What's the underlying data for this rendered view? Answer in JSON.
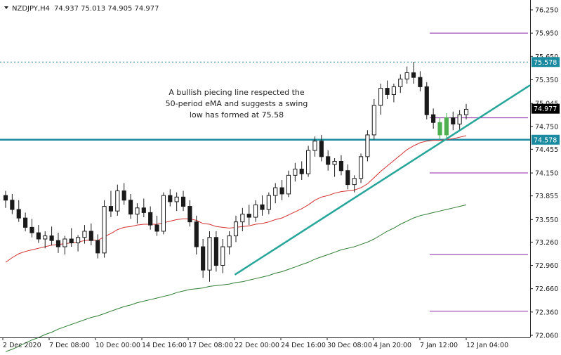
{
  "header": {
    "symbol_info": "NZDJPY,H4",
    "ohlc": "74.937 75.013 74.905 74.977"
  },
  "annotation": {
    "lines": [
      "A bullish piecing line respected the",
      "50-period eMA and suggests a swing",
      "low has formed at 75.58"
    ]
  },
  "colors": {
    "candle": "#1a1a1a",
    "highlight": "#4caf50",
    "ema_fast": "#d32f2f",
    "ema_slow": "#2e7d32",
    "trendline": "#26a69a",
    "support_line": "#1a8aa0",
    "level_lines": "#8e24aa",
    "price_tag": "#1a8aa0",
    "current_tag": "#000000"
  },
  "chart_data": {
    "type": "candlestick",
    "y_ticks": [
      "76.250",
      "75.950",
      "75.650",
      "75.350",
      "75.045",
      "74.750",
      "74.455",
      "74.150",
      "73.855",
      "73.550",
      "73.260",
      "72.960",
      "72.660",
      "72.360",
      "72.060"
    ],
    "x_ticks": [
      "2 Dec 2020",
      "7 Dec 08:00",
      "10 Dec 00:00",
      "14 Dec 16:00",
      "17 Dec 08:00",
      "22 Dec 00:00",
      "24 Dec 16:00",
      "30 Dec 08:00",
      "4 Jan 20:00",
      "7 Jan 12:00",
      "12 Jan 04:00"
    ],
    "ylim": [
      72.06,
      76.25
    ],
    "current_price": "74.977",
    "dotted_level": "75.578",
    "support_level": "74.578",
    "horizontal_levels": [
      75.95,
      74.86,
      74.15,
      73.1,
      72.37
    ],
    "trendline": {
      "from": [
        0.44,
        72.84
      ],
      "to": [
        1.0,
        75.28
      ]
    },
    "candles": [
      {
        "o": 73.86,
        "h": 73.92,
        "l": 73.7,
        "c": 73.8
      },
      {
        "o": 73.8,
        "h": 73.88,
        "l": 73.62,
        "c": 73.68
      },
      {
        "o": 73.68,
        "h": 73.8,
        "l": 73.52,
        "c": 73.57
      },
      {
        "o": 73.57,
        "h": 73.64,
        "l": 73.4,
        "c": 73.45
      },
      {
        "o": 73.45,
        "h": 73.56,
        "l": 73.32,
        "c": 73.38
      },
      {
        "o": 73.38,
        "h": 73.48,
        "l": 73.25,
        "c": 73.3
      },
      {
        "o": 73.3,
        "h": 73.4,
        "l": 73.18,
        "c": 73.34
      },
      {
        "o": 73.34,
        "h": 73.46,
        "l": 73.22,
        "c": 73.28
      },
      {
        "o": 73.28,
        "h": 73.38,
        "l": 73.12,
        "c": 73.2
      },
      {
        "o": 73.2,
        "h": 73.34,
        "l": 73.1,
        "c": 73.3
      },
      {
        "o": 73.3,
        "h": 73.44,
        "l": 73.2,
        "c": 73.25
      },
      {
        "o": 73.25,
        "h": 73.35,
        "l": 73.14,
        "c": 73.32
      },
      {
        "o": 73.32,
        "h": 73.48,
        "l": 73.24,
        "c": 73.4
      },
      {
        "o": 73.4,
        "h": 73.5,
        "l": 73.22,
        "c": 73.28
      },
      {
        "o": 73.28,
        "h": 73.36,
        "l": 73.05,
        "c": 73.12
      },
      {
        "o": 73.12,
        "h": 73.8,
        "l": 73.06,
        "c": 73.72
      },
      {
        "o": 73.72,
        "h": 73.92,
        "l": 73.58,
        "c": 73.66
      },
      {
        "o": 73.66,
        "h": 74.0,
        "l": 73.6,
        "c": 73.92
      },
      {
        "o": 73.92,
        "h": 74.02,
        "l": 73.74,
        "c": 73.8
      },
      {
        "o": 73.8,
        "h": 73.88,
        "l": 73.56,
        "c": 73.62
      },
      {
        "o": 73.62,
        "h": 73.76,
        "l": 73.5,
        "c": 73.7
      },
      {
        "o": 73.7,
        "h": 73.82,
        "l": 73.58,
        "c": 73.64
      },
      {
        "o": 73.64,
        "h": 73.72,
        "l": 73.42,
        "c": 73.48
      },
      {
        "o": 73.48,
        "h": 73.6,
        "l": 73.34,
        "c": 73.4
      },
      {
        "o": 73.4,
        "h": 73.9,
        "l": 73.36,
        "c": 73.86
      },
      {
        "o": 73.86,
        "h": 73.94,
        "l": 73.72,
        "c": 73.78
      },
      {
        "o": 73.78,
        "h": 73.9,
        "l": 73.66,
        "c": 73.84
      },
      {
        "o": 73.84,
        "h": 73.92,
        "l": 73.66,
        "c": 73.72
      },
      {
        "o": 73.72,
        "h": 73.8,
        "l": 73.46,
        "c": 73.52
      },
      {
        "o": 73.52,
        "h": 73.6,
        "l": 73.1,
        "c": 73.2
      },
      {
        "o": 73.2,
        "h": 73.3,
        "l": 72.8,
        "c": 72.9
      },
      {
        "o": 72.9,
        "h": 73.4,
        "l": 72.75,
        "c": 73.32
      },
      {
        "o": 73.32,
        "h": 73.4,
        "l": 72.88,
        "c": 72.96
      },
      {
        "o": 72.96,
        "h": 73.3,
        "l": 72.86,
        "c": 73.2
      },
      {
        "o": 73.2,
        "h": 73.4,
        "l": 73.1,
        "c": 73.34
      },
      {
        "o": 73.34,
        "h": 73.6,
        "l": 73.26,
        "c": 73.52
      },
      {
        "o": 73.52,
        "h": 73.7,
        "l": 73.4,
        "c": 73.62
      },
      {
        "o": 73.62,
        "h": 73.74,
        "l": 73.48,
        "c": 73.58
      },
      {
        "o": 73.58,
        "h": 73.8,
        "l": 73.52,
        "c": 73.74
      },
      {
        "o": 73.74,
        "h": 73.86,
        "l": 73.6,
        "c": 73.68
      },
      {
        "o": 73.68,
        "h": 73.9,
        "l": 73.62,
        "c": 73.86
      },
      {
        "o": 73.86,
        "h": 74.02,
        "l": 73.76,
        "c": 73.96
      },
      {
        "o": 73.96,
        "h": 74.06,
        "l": 73.8,
        "c": 73.88
      },
      {
        "o": 73.88,
        "h": 74.18,
        "l": 73.84,
        "c": 74.12
      },
      {
        "o": 74.12,
        "h": 74.28,
        "l": 74.04,
        "c": 74.2
      },
      {
        "o": 74.2,
        "h": 74.3,
        "l": 74.06,
        "c": 74.14
      },
      {
        "o": 74.14,
        "h": 74.5,
        "l": 74.1,
        "c": 74.44
      },
      {
        "o": 74.44,
        "h": 74.62,
        "l": 74.36,
        "c": 74.56
      },
      {
        "o": 74.56,
        "h": 74.64,
        "l": 74.3,
        "c": 74.36
      },
      {
        "o": 74.36,
        "h": 74.44,
        "l": 74.18,
        "c": 74.26
      },
      {
        "o": 74.26,
        "h": 74.34,
        "l": 74.1,
        "c": 74.3
      },
      {
        "o": 74.3,
        "h": 74.38,
        "l": 74.12,
        "c": 74.18
      },
      {
        "o": 74.18,
        "h": 74.26,
        "l": 73.94,
        "c": 74.0
      },
      {
        "o": 74.0,
        "h": 74.12,
        "l": 73.9,
        "c": 74.08
      },
      {
        "o": 74.08,
        "h": 74.4,
        "l": 74.02,
        "c": 74.36
      },
      {
        "o": 74.36,
        "h": 74.7,
        "l": 74.3,
        "c": 74.64
      },
      {
        "o": 74.64,
        "h": 75.1,
        "l": 74.58,
        "c": 75.02
      },
      {
        "o": 75.02,
        "h": 75.3,
        "l": 74.9,
        "c": 75.24
      },
      {
        "o": 75.24,
        "h": 75.34,
        "l": 75.1,
        "c": 75.16
      },
      {
        "o": 75.16,
        "h": 75.3,
        "l": 75.06,
        "c": 75.26
      },
      {
        "o": 75.26,
        "h": 75.42,
        "l": 75.18,
        "c": 75.36
      },
      {
        "o": 75.36,
        "h": 75.52,
        "l": 75.3,
        "c": 75.44
      },
      {
        "o": 75.44,
        "h": 75.58,
        "l": 75.3,
        "c": 75.38
      },
      {
        "o": 75.38,
        "h": 75.46,
        "l": 75.2,
        "c": 75.26
      },
      {
        "o": 75.26,
        "h": 75.32,
        "l": 74.84,
        "c": 74.9
      },
      {
        "o": 74.9,
        "h": 74.98,
        "l": 74.72,
        "c": 74.8
      },
      {
        "o": 74.8,
        "h": 74.86,
        "l": 74.58,
        "c": 74.64,
        "hl": true
      },
      {
        "o": 74.64,
        "h": 74.92,
        "l": 74.6,
        "c": 74.86,
        "hl": true
      },
      {
        "o": 74.86,
        "h": 74.94,
        "l": 74.7,
        "c": 74.78
      },
      {
        "o": 74.78,
        "h": 74.96,
        "l": 74.7,
        "c": 74.9
      },
      {
        "o": 74.9,
        "h": 75.04,
        "l": 74.84,
        "c": 74.97
      }
    ],
    "ema_fast": [
      73.0,
      73.06,
      73.11,
      73.14,
      73.16,
      73.18,
      73.2,
      73.22,
      73.23,
      73.24,
      73.25,
      73.26,
      73.28,
      73.29,
      73.28,
      73.33,
      73.37,
      73.42,
      73.45,
      73.46,
      73.48,
      73.49,
      73.49,
      73.49,
      73.51,
      73.53,
      73.55,
      73.56,
      73.56,
      73.54,
      73.5,
      73.49,
      73.46,
      73.45,
      73.44,
      73.45,
      73.46,
      73.47,
      73.49,
      73.5,
      73.52,
      73.55,
      73.57,
      73.61,
      73.65,
      73.69,
      73.74,
      73.8,
      73.84,
      73.86,
      73.89,
      73.91,
      73.92,
      73.93,
      73.96,
      74.01,
      74.09,
      74.17,
      74.24,
      74.31,
      74.38,
      74.45,
      74.5,
      74.54,
      74.56,
      74.57,
      74.57,
      74.58,
      74.59,
      74.61,
      74.63
    ],
    "ema_slow": [
      71.85,
      71.88,
      71.92,
      71.96,
      72.0,
      72.03,
      72.07,
      72.1,
      72.14,
      72.17,
      72.2,
      72.23,
      72.26,
      72.29,
      72.31,
      72.34,
      72.37,
      72.4,
      72.43,
      72.45,
      72.48,
      72.5,
      72.52,
      72.54,
      72.56,
      72.58,
      72.61,
      72.63,
      72.65,
      72.66,
      72.67,
      72.69,
      72.7,
      72.71,
      72.72,
      72.74,
      72.75,
      72.77,
      72.79,
      72.81,
      72.83,
      72.86,
      72.88,
      72.91,
      72.94,
      72.97,
      73.0,
      73.04,
      73.07,
      73.1,
      73.13,
      73.16,
      73.18,
      73.2,
      73.23,
      73.26,
      73.3,
      73.35,
      73.4,
      73.44,
      73.49,
      73.53,
      73.57,
      73.6,
      73.62,
      73.64,
      73.66,
      73.68,
      73.7,
      73.72,
      73.74
    ]
  }
}
